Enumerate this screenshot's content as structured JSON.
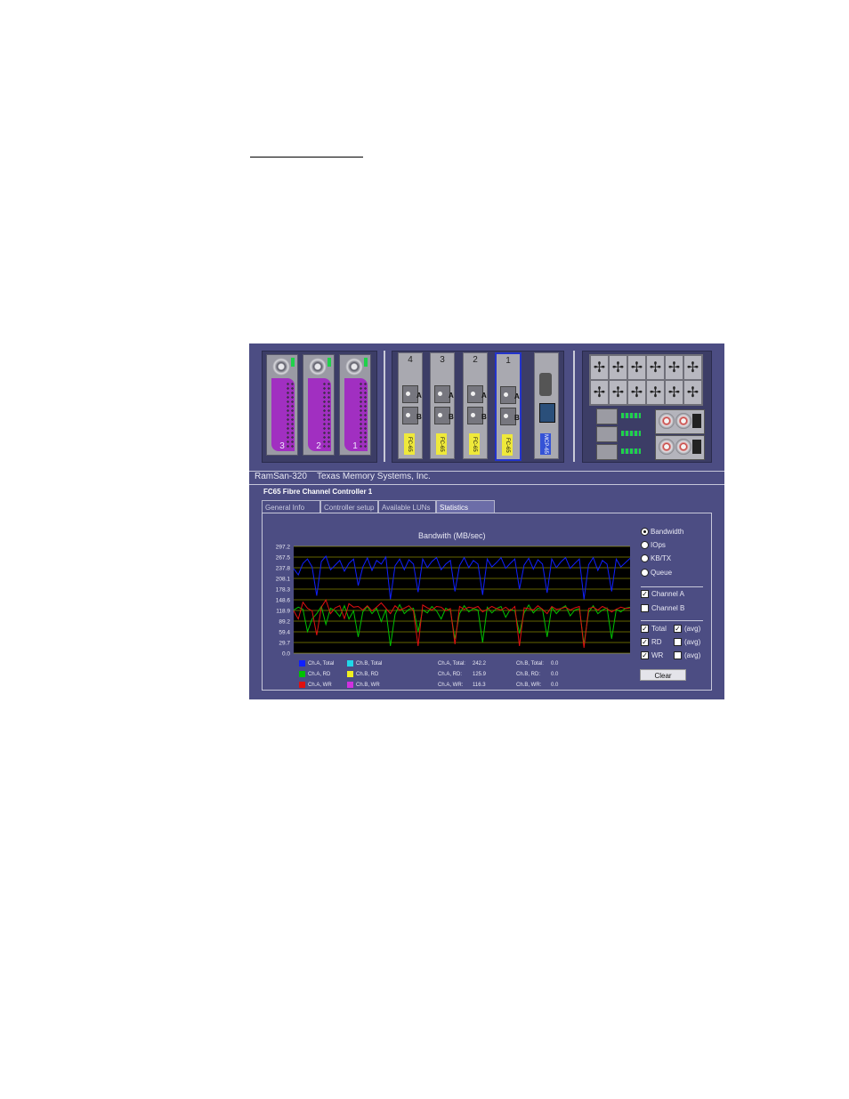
{
  "window": {
    "product": "RamSan-320",
    "vendor": "Texas Memory Systems, Inc."
  },
  "hardware": {
    "drive_bays": [
      "3",
      "2",
      "1"
    ],
    "fc_cards": [
      {
        "num": "4",
        "label": "FC-65"
      },
      {
        "num": "3",
        "label": "FC-65"
      },
      {
        "num": "2",
        "label": "FC-65"
      },
      {
        "num": "1",
        "label": "FC-65",
        "selected": true
      }
    ],
    "port_labels": [
      "A",
      "B"
    ],
    "mcp_label": "MCP-65",
    "accent_green": "#1fd14a",
    "accent_purple": "#a12fc1"
  },
  "controller_title": "FC65 Fibre Channel Controller 1",
  "tabs": [
    "General Info",
    "Controller setup",
    "Available LUNs",
    "Statistics"
  ],
  "active_tab": "Statistics",
  "chart_data": {
    "type": "line",
    "title": "Bandwith (MB/sec)",
    "xlabel": "",
    "ylabel": "",
    "yticks": [
      "297.2",
      "267.5",
      "237.8",
      "208.1",
      "178.3",
      "148.6",
      "118.9",
      "89.2",
      "59.4",
      "29.7",
      "0.0"
    ],
    "ylim": [
      0,
      297.2
    ],
    "grid": true,
    "series": [
      {
        "name": "Ch.A, Total",
        "color": "#1020ff",
        "values": [
          235,
          218,
          250,
          262,
          240,
          160,
          255,
          270,
          232,
          245,
          258,
          228,
          250,
          262,
          188,
          240,
          265,
          230,
          258,
          248,
          268,
          150,
          243,
          262,
          232,
          260,
          248,
          170,
          262,
          238,
          255,
          266,
          232,
          248,
          258,
          172,
          244,
          266,
          238,
          258,
          248,
          162,
          262,
          240,
          252,
          266,
          236,
          250,
          262,
          178,
          245,
          264,
          234,
          260,
          248,
          168,
          262,
          238,
          254,
          266,
          236,
          250,
          262,
          150,
          246,
          266,
          230,
          258,
          248,
          172,
          262,
          240,
          252,
          264
        ]
      },
      {
        "name": "Ch.A, RD",
        "color": "#00c200",
        "values": [
          120,
          128,
          122,
          60,
          95,
          110,
          130,
          80,
          125,
          118,
          102,
          132,
          95,
          118,
          45,
          115,
          130,
          110,
          125,
          88,
          120,
          20,
          108,
          135,
          110,
          122,
          125,
          60,
          120,
          112,
          130,
          118,
          95,
          125,
          118,
          40,
          110,
          132,
          115,
          124,
          120,
          30,
          128,
          112,
          124,
          130,
          100,
          122,
          118,
          55,
          112,
          134,
          112,
          125,
          122,
          45,
          128,
          110,
          124,
          132,
          104,
          120,
          124,
          25,
          114,
          132,
          110,
          120,
          126,
          40,
          122,
          115,
          125,
          128
        ]
      },
      {
        "name": "Ch.A, WR",
        "color": "#e01010",
        "values": [
          118,
          95,
          142,
          125,
          118,
          50,
          128,
          148,
          110,
          126,
          132,
          96,
          138,
          128,
          130,
          120,
          132,
          118,
          128,
          140,
          125,
          110,
          132,
          120,
          125,
          132,
          118,
          20,
          134,
          126,
          120,
          130,
          128,
          118,
          124,
          25,
          130,
          122,
          128,
          125,
          130,
          115,
          122,
          130,
          124,
          120,
          128,
          118,
          130,
          20,
          126,
          124,
          120,
          132,
          122,
          110,
          130,
          122,
          124,
          128,
          120,
          126,
          130,
          15,
          124,
          128,
          120,
          130,
          124,
          115,
          122,
          128,
          124,
          126
        ]
      }
    ]
  },
  "legend": [
    {
      "label": "Ch.A, Total",
      "color": "#1020ff"
    },
    {
      "label": "Ch.B, Total",
      "color": "#20d8e8"
    },
    {
      "label": "Ch.A, RD",
      "color": "#00c200"
    },
    {
      "label": "Ch.B, RD",
      "color": "#f0f020"
    },
    {
      "label": "Ch.A, WR",
      "color": "#e01010"
    },
    {
      "label": "Ch.B, WR",
      "color": "#d030e0"
    }
  ],
  "stats": [
    {
      "label": "Ch.A, Total:",
      "value": "242.2"
    },
    {
      "label": "Ch.B, Total:",
      "value": "0.0"
    },
    {
      "label": "Ch.A, RD:",
      "value": "125.9"
    },
    {
      "label": "Ch.B, RD:",
      "value": "0.0"
    },
    {
      "label": "Ch.A, WR:",
      "value": "116.3"
    },
    {
      "label": "Ch.B, WR:",
      "value": "0.0"
    }
  ],
  "controls": {
    "radios": [
      {
        "label": "Bandwidth",
        "checked": true
      },
      {
        "label": "IOps",
        "checked": false
      },
      {
        "label": "KB/TX",
        "checked": false
      },
      {
        "label": "Queue",
        "checked": false
      }
    ],
    "channels": [
      {
        "label": "Channel A",
        "checked": true
      },
      {
        "label": "Channel B",
        "checked": false
      }
    ],
    "metrics": [
      {
        "label": "Total",
        "checked": true,
        "avg_label": "(avg)",
        "avg_checked": true
      },
      {
        "label": "RD",
        "checked": true,
        "avg_label": "(avg)",
        "avg_checked": false
      },
      {
        "label": "WR",
        "checked": true,
        "avg_label": "(avg)",
        "avg_checked": false
      }
    ],
    "clear_label": "Clear"
  }
}
